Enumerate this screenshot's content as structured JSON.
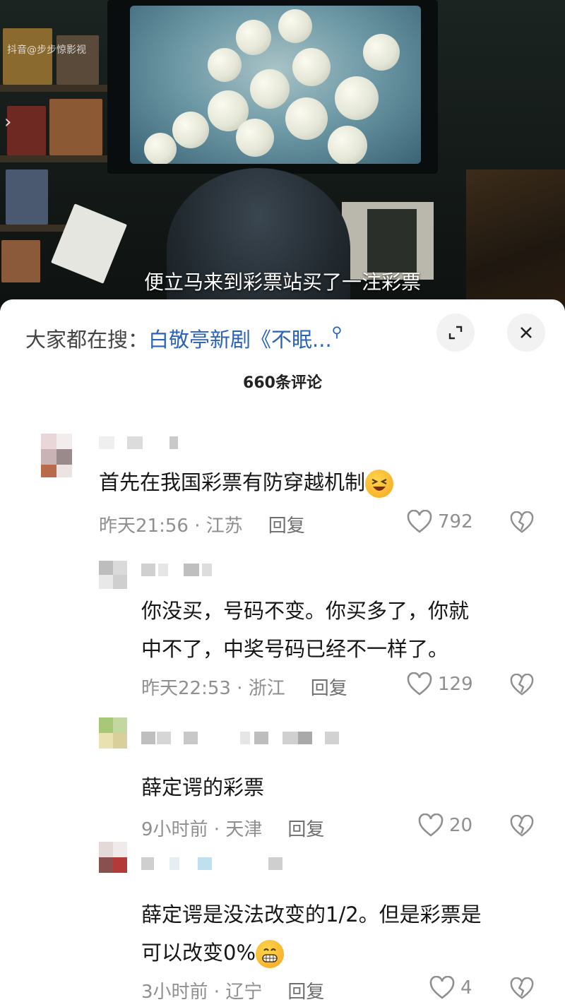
{
  "video": {
    "watermark": "抖音@步步惊影视",
    "subtitle": "便立马来到彩票站买了一注彩票"
  },
  "sheet": {
    "search_prefix": "大家都在搜：",
    "search_link": "白敬亭新剧《不眠...",
    "comment_count": "660条评论"
  },
  "comments": [
    {
      "text": "首先在我国彩票有防穿越机制",
      "time_location": "昨天21:56 · 江苏",
      "reply_label": "回复",
      "likes": "792"
    },
    {
      "text_line1": "你没买，号码不变。你买多了，你就",
      "text_line2": "中不了，中奖号码已经不一样了。",
      "time_location": "昨天22:53 · 浙江",
      "reply_label": "回复",
      "likes": "129"
    },
    {
      "text": "薛定谔的彩票",
      "time_location": "9小时前 · 天津",
      "reply_label": "回复",
      "likes": "20"
    },
    {
      "text_line1": "薛定谔是没法改变的1/2。但是彩票是",
      "text_line2": "可以改变0%",
      "time_location": "3小时前 · 辽宁",
      "reply_label": "回复",
      "likes": "4"
    }
  ],
  "colors": {
    "link": "#2a63b8",
    "meta": "#8f8f8f"
  },
  "icons": [
    "chevron-right-icon",
    "search-icon",
    "expand-icon",
    "close-icon",
    "heart-icon",
    "broken-heart-icon",
    "laughing-emoji-icon",
    "grinning-emoji-icon"
  ]
}
